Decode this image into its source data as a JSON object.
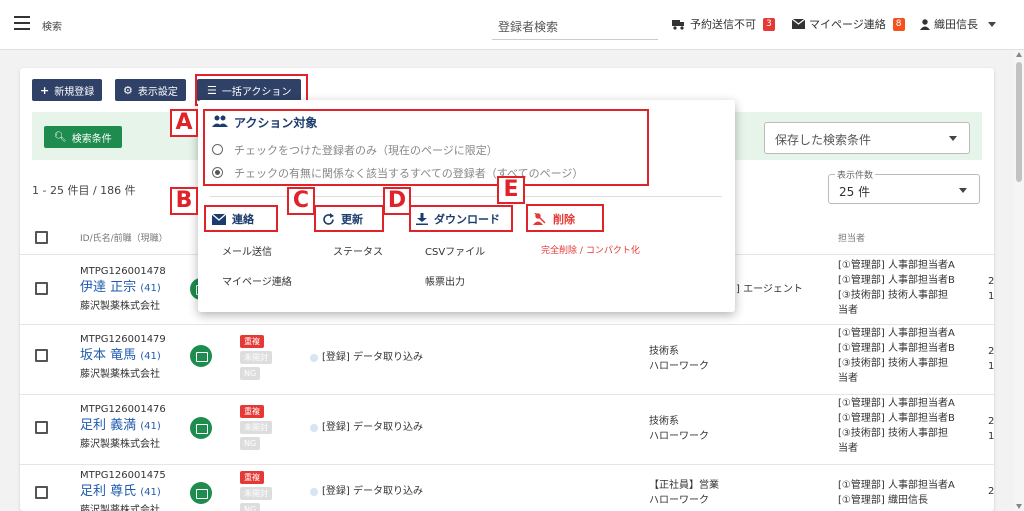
{
  "topbar": {
    "title": "検索",
    "search_label": "登録者検索",
    "reservation_label": "予約送信不可",
    "reservation_count": "3",
    "mypage_label": "マイページ連絡",
    "mypage_count": "8",
    "user_name": "織田信長"
  },
  "toolbar": {
    "new_label": "新規登録",
    "display_label": "表示設定",
    "bulk_label": "一括アクション"
  },
  "filter": {
    "search_btn": "検索条件",
    "saved_placeholder": "保存した検索条件"
  },
  "list": {
    "count_text": "1 - 25 件目 / 186 件",
    "perpage_label": "表示件数",
    "perpage_value": "25 件",
    "headers": {
      "id": "ID/氏名/前職（現職）",
      "owner": "担当者"
    },
    "rows": [
      {
        "id": "MTPG126001478",
        "name": "伊達 正宗",
        "age": "(41)",
        "company": "藤沢製薬株式会社",
        "col_agent": "] エージェント",
        "owners": [
          "[①管理部] 人事部担当者A",
          "[①管理部] 人事部担当者B",
          "[③技術部] 技術人事部担",
          "当者"
        ]
      },
      {
        "id": "MTPG126001479",
        "name": "坂本 竜馬",
        "age": "(41)",
        "company": "藤沢製薬株式会社",
        "tags": [
          "重複",
          "未開封",
          "NG"
        ],
        "status": "[登録] データ取り込み",
        "job": [
          "技術系",
          "ハローワーク"
        ],
        "owners": [
          "[①管理部] 人事部担当者A",
          "[①管理部] 人事部担当者B",
          "[③技術部] 技術人事部担",
          "当者"
        ]
      },
      {
        "id": "MTPG126001476",
        "name": "足利 義満",
        "age": "(41)",
        "company": "藤沢製薬株式会社",
        "tags": [
          "重複",
          "未開封",
          "NG"
        ],
        "status": "[登録] データ取り込み",
        "job": [
          "技術系",
          "ハローワーク"
        ],
        "owners": [
          "[①管理部] 人事部担当者A",
          "[①管理部] 人事部担当者B",
          "[③技術部] 技術人事部担",
          "当者"
        ]
      },
      {
        "id": "MTPG126001475",
        "name": "足利 尊氏",
        "age": "(41)",
        "company": "藤沢製薬株式会社",
        "tags": [
          "重複",
          "未開封",
          "NG"
        ],
        "status": "[登録] データ取り込み",
        "job": [
          "【正社員】営業",
          "ハローワーク"
        ],
        "owners": [
          "[①管理部] 人事部担当者A",
          "[①管理部] 織田信長"
        ]
      }
    ],
    "right_edge": [
      "2",
      "1",
      "2",
      "1",
      "2",
      "1",
      "2"
    ]
  },
  "popup": {
    "heading": "アクション対象",
    "radio1": "チェックをつけた登録者のみ（現在のページに限定）",
    "radio2": "チェックの有無に関係なく該当するすべての登録者（すべてのページ）",
    "cat_contact": "連絡",
    "cat_update": "更新",
    "cat_download": "ダウンロード",
    "cat_delete": "削除",
    "item_mail": "メール送信",
    "item_mypage": "マイページ連絡",
    "item_status": "ステータス",
    "item_csv": "CSVファイル",
    "item_report": "帳票出力",
    "item_delete_full": "完全削除",
    "item_delete_sep": "/",
    "item_delete_compact": "コンパクト化"
  },
  "annotations": {
    "A": "A",
    "B": "B",
    "C": "C",
    "D": "D",
    "E": "E"
  },
  "colors": {
    "navy": "#2f4166",
    "green": "#1e8c4e",
    "red": "#e0222a",
    "link": "#1f5cae"
  }
}
